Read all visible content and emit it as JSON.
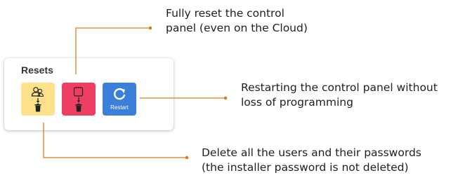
{
  "panel": {
    "title": "Resets"
  },
  "tiles": [
    {
      "icon": "users-delete-icon",
      "color": "#fde28b"
    },
    {
      "icon": "panel-reset-icon",
      "color": "#ee3f63"
    },
    {
      "icon": "restart-icon",
      "color": "#3a7fd8",
      "label": "Restart"
    }
  ],
  "callouts": {
    "reset": {
      "line1": "Fully reset the control",
      "line2": "panel (even on the Cloud)"
    },
    "restart": {
      "line1": "Restarting the control panel without",
      "line2": "loss of programming"
    },
    "delete": {
      "line1": "Delete all the users and their passwords",
      "line2": "(the installer password is not deleted)"
    }
  },
  "colors": {
    "leader": "#e07b1a",
    "users_tile": "#fde28b",
    "reset_tile": "#ee3f63",
    "restart_tile": "#3a7fd8"
  }
}
